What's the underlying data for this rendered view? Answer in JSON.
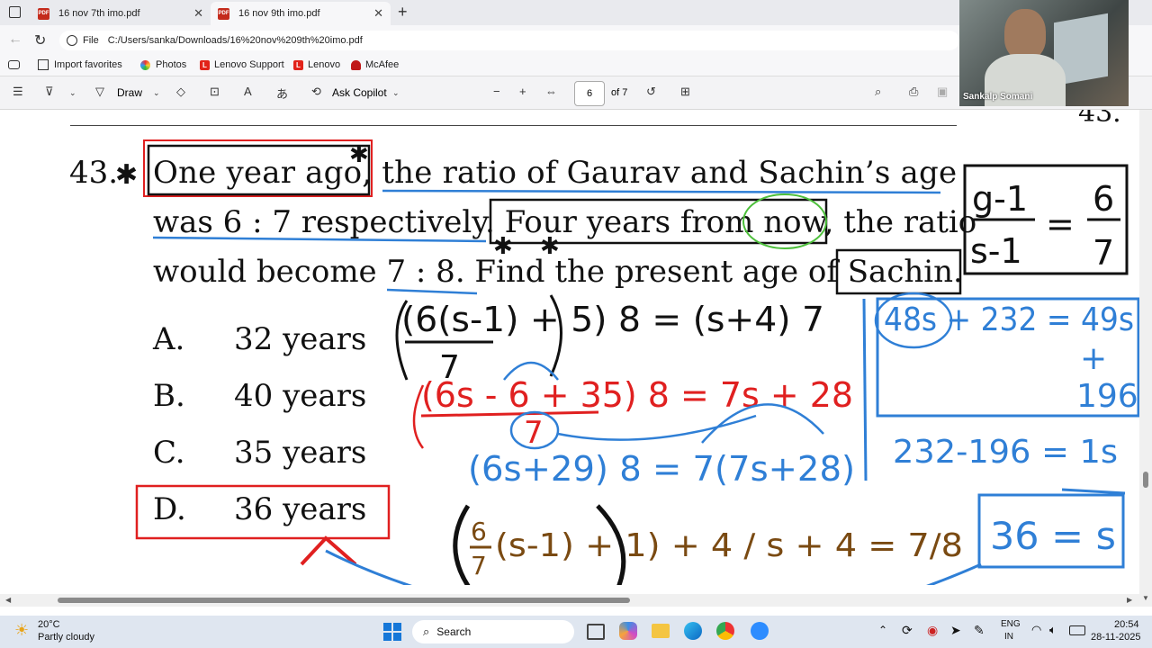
{
  "tabs": [
    {
      "title": "16 nov 7th imo.pdf"
    },
    {
      "title": "16 nov 9th imo.pdf"
    }
  ],
  "address": {
    "scheme": "File",
    "url": "C:/Users/sanka/Downloads/16%20nov%209th%20imo.pdf"
  },
  "favorites": [
    "Import favorites",
    "Photos",
    "Lenovo Support",
    "Lenovo",
    "McAfee"
  ],
  "toolbar": {
    "draw": "Draw",
    "copilot": "Ask Copilot",
    "page": "6",
    "of": "of 7",
    "badge": "L",
    "minus": "−",
    "plus": "+"
  },
  "video": {
    "name": "Sankalp Somani"
  },
  "question": {
    "number": "43.",
    "line1a": "One year ago,",
    "line1b": " the ratio of Gaurav and Sachin’s age",
    "line2a": "was 6 : 7 respectively.",
    "line2b": "Four years from now,",
    "line2c": " the ratio",
    "line3a": "would become 7 : 8. Find the present age of ",
    "line3b": "Sachin."
  },
  "prev_number": "43.",
  "options": [
    {
      "letter": "A.",
      "text": "32 years"
    },
    {
      "letter": "B.",
      "text": "40 years"
    },
    {
      "letter": "C.",
      "text": "35 years"
    },
    {
      "letter": "D.",
      "text": "36 years"
    }
  ],
  "annotations": {
    "box_g": "g-1",
    "box_s": "s-1",
    "box_eq": "=",
    "box_6": "6",
    "box_7": "7",
    "eq1": "(6(s-1) + 5) 8 = (s+4) 7",
    "eq1_den": "7",
    "eq2": "(6s - 6 + 35) 8 = 7s + 28",
    "eq2_den": "7",
    "eq3": "(6s+29) 8 = 7(7s+28)",
    "right1": "48s + 232 = 49s",
    "right2": "+",
    "right3": "196",
    "right4": "232-196 = 1s",
    "right5": "36 = s",
    "eq4a": "6",
    "eq4b": "7",
    "eq4c": "(s-1) + 1) + 4 / s + 4 = 7/8"
  },
  "taskbar": {
    "temp": "20°C",
    "weather": "Partly cloudy",
    "search": "Search",
    "lang1": "ENG",
    "lang2": "IN",
    "time": "20:54",
    "date": "28-11-2025"
  },
  "colors": {
    "red": "#e02020",
    "blue": "#2f7fd6",
    "black": "#111111",
    "green": "#4cbf3a",
    "brown": "#7a4a12"
  }
}
